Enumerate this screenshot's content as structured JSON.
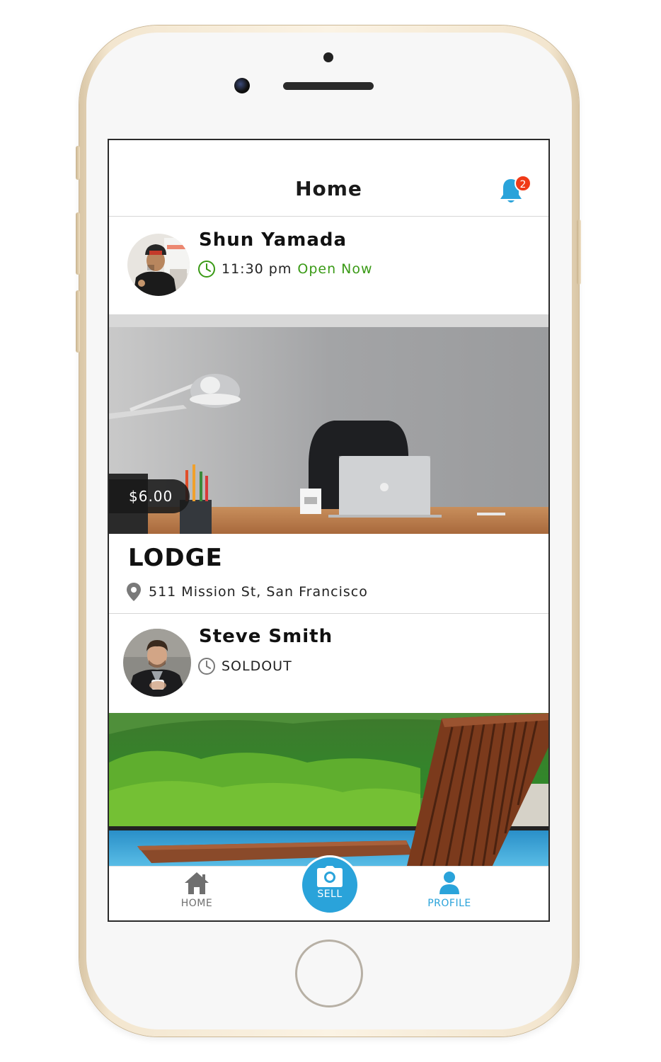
{
  "header": {
    "title": "Home",
    "notification_count": "2"
  },
  "posts": [
    {
      "user_name": "Shun Yamada",
      "time": "11:30 pm",
      "status": "Open Now",
      "price": "$6.00",
      "listing_title": "LODGE",
      "address": "511 Mission St, San Francisco"
    },
    {
      "user_name": "Steve Smith",
      "status": "SOLDOUT"
    }
  ],
  "tabbar": {
    "home_label": "HOME",
    "sell_label": "SELL",
    "profile_label": "PROFILE"
  },
  "colors": {
    "accent": "#2aa3da",
    "open_green": "#3a9a16",
    "badge_red": "#f03a17",
    "inactive_gray": "#6f6f6f"
  },
  "icons": [
    "bell-icon",
    "clock-icon",
    "location-pin-icon",
    "home-icon",
    "camera-icon",
    "person-icon"
  ]
}
